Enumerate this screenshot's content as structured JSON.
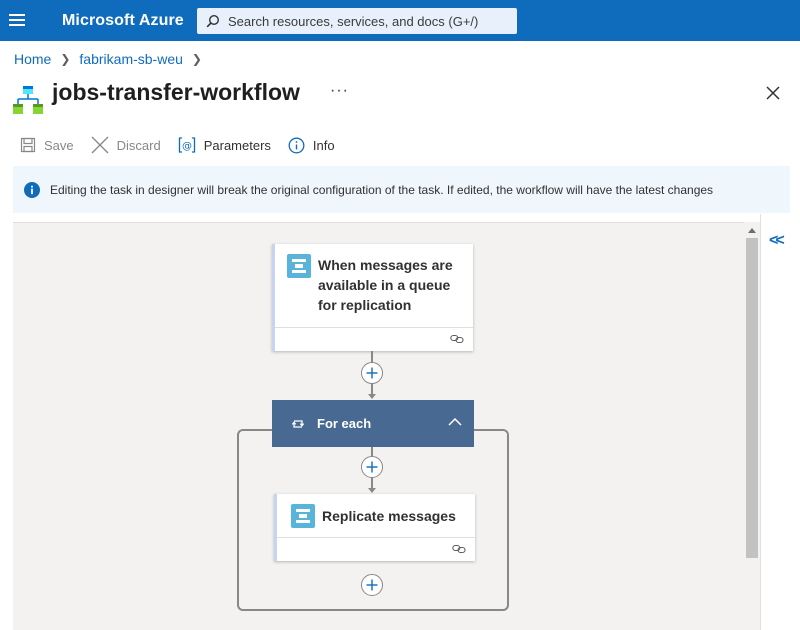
{
  "topbar": {
    "brand": "Microsoft Azure",
    "search_placeholder": "Search resources, services, and docs (G+/)"
  },
  "breadcrumb": [
    {
      "label": "Home"
    },
    {
      "label": "fabrikam-sb-weu"
    }
  ],
  "page": {
    "title": "jobs-transfer-workflow",
    "more": "···"
  },
  "toolbar": {
    "save": "Save",
    "discard": "Discard",
    "parameters": "Parameters",
    "info": "Info"
  },
  "banner": {
    "text": "Editing the task in designer will break the original configuration of the task. If edited, the workflow will have the latest changes"
  },
  "designer": {
    "trigger": {
      "title_lines": [
        "When messages are",
        "available in a queue",
        "for replication"
      ]
    },
    "foreach": {
      "label": "For each"
    },
    "action": {
      "title": "Replicate messages"
    },
    "collapse": "<<"
  },
  "colors": {
    "accent": "#0f6cbd",
    "foreach_header": "#486991",
    "servicebus_icon": "#59b4d9"
  }
}
